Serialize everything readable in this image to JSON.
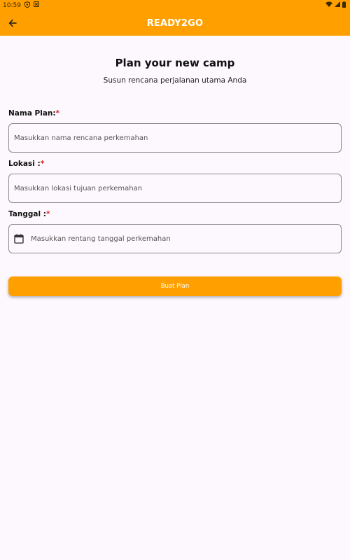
{
  "status_bar": {
    "time": "10:59"
  },
  "app_bar": {
    "title": "READY2GO"
  },
  "header": {
    "title": "Plan your new camp",
    "subtitle": "Susun rencana perjalanan utama Anda"
  },
  "form": {
    "name": {
      "label": "Nama Plan:",
      "required_mark": "*",
      "placeholder": "Masukkan nama rencana perkemahan",
      "value": ""
    },
    "location": {
      "label": "Lokasi :",
      "required_mark": "*",
      "placeholder": "Masukkan lokasi tujuan perkemahan",
      "value": ""
    },
    "date": {
      "label": "Tanggal :",
      "required_mark": "*",
      "placeholder": "Masukkan rentang tanggal perkemahan",
      "value": "",
      "icon": "calendar-icon"
    },
    "submit_label": "Buat Plan"
  },
  "colors": {
    "primary": "#ffa000",
    "background": "#fdf8fd",
    "required": "#e02020"
  }
}
